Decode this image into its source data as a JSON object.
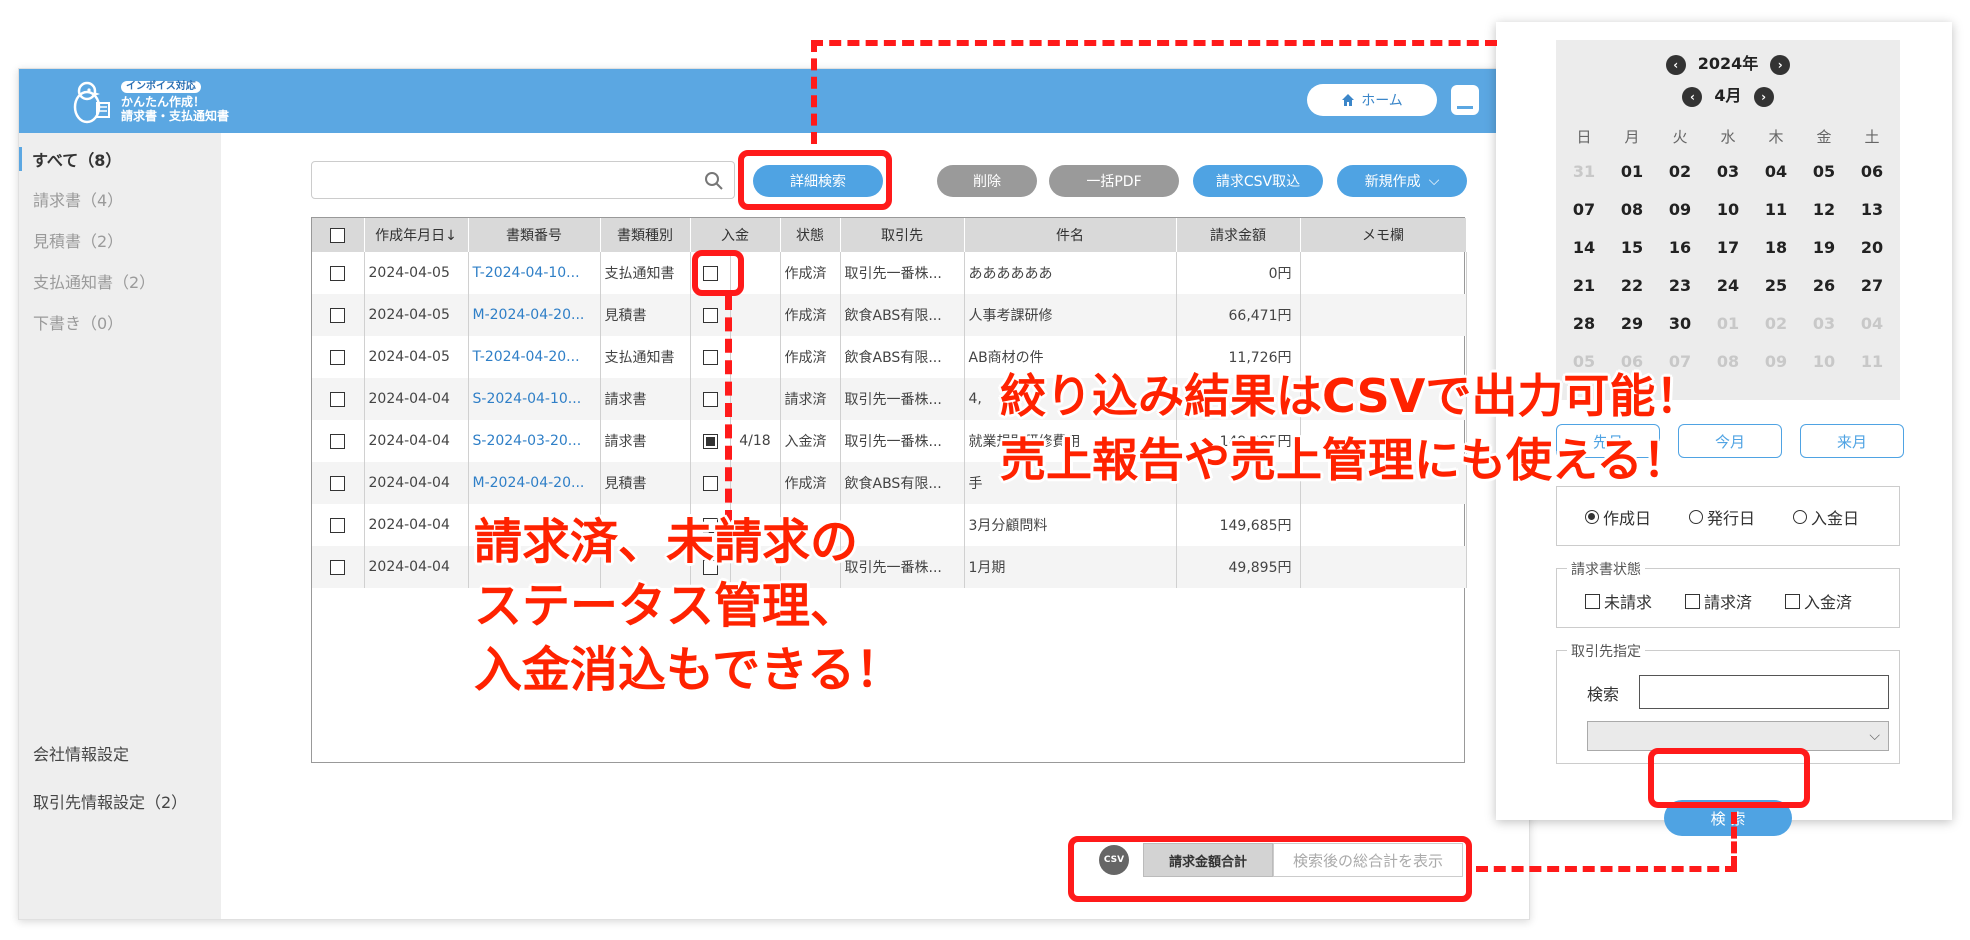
{
  "brand": {
    "badge": "インボイス対応",
    "line1": "かんたん作成！",
    "line2": "請求書・支払通知書"
  },
  "header": {
    "home_label": "ホーム"
  },
  "sidebar": {
    "items": [
      {
        "label": "すべて（8）"
      },
      {
        "label": "請求書（4）"
      },
      {
        "label": "見積書（2）"
      },
      {
        "label": "支払通知書（2）"
      },
      {
        "label": "下書き（0）"
      }
    ],
    "bottom": [
      {
        "label": "会社情報設定"
      },
      {
        "label": "取引先情報設定（2）"
      }
    ]
  },
  "toolbar": {
    "search_placeholder": "",
    "detail_search": "詳細検索",
    "delete": "削除",
    "bulk_pdf": "一括PDF",
    "csv_import": "請求CSV取込",
    "new_create": "新規作成"
  },
  "table": {
    "headers": [
      "",
      "作成年月日↓",
      "書類番号",
      "書類種別",
      "入金",
      "状態",
      "取引先",
      "件名",
      "請求金額",
      "メモ欄"
    ],
    "rows": [
      {
        "date": "2024-04-05",
        "doc_no": "T-2024-04-10...",
        "type": "支払通知書",
        "paid_checked": false,
        "paid_date": "",
        "status": "作成済",
        "client": "取引先一番株...",
        "subject": "ああああああ",
        "amount": "0円"
      },
      {
        "date": "2024-04-05",
        "doc_no": "M-2024-04-20...",
        "type": "見積書",
        "paid_checked": false,
        "paid_date": "",
        "status": "作成済",
        "client": "飲食ABS有限...",
        "subject": "人事考課研修",
        "amount": "66,471円"
      },
      {
        "date": "2024-04-05",
        "doc_no": "T-2024-04-20...",
        "type": "支払通知書",
        "paid_checked": false,
        "paid_date": "",
        "status": "作成済",
        "client": "飲食ABS有限...",
        "subject": "AB商材の件",
        "amount": "11,726円"
      },
      {
        "date": "2024-04-04",
        "doc_no": "S-2024-04-10...",
        "type": "請求書",
        "paid_checked": false,
        "paid_date": "",
        "status": "請求済",
        "client": "取引先一番株...",
        "subject": "4,",
        "amount": ""
      },
      {
        "date": "2024-04-04",
        "doc_no": "S-2024-03-20...",
        "type": "請求書",
        "paid_checked": true,
        "paid_date": "4/18",
        "status": "入金済",
        "client": "取引先一番株...",
        "subject": "就業規則研修費用",
        "amount": "149,685円"
      },
      {
        "date": "2024-04-04",
        "doc_no": "M-2024-04-20...",
        "type": "見積書",
        "paid_checked": false,
        "paid_date": "",
        "status": "作成済",
        "client": "飲食ABS有限...",
        "subject": "手",
        "amount": ""
      },
      {
        "date": "2024-04-04",
        "doc_no": "",
        "type": "",
        "paid_checked": false,
        "paid_date": "",
        "status": "",
        "client": "",
        "subject": "3月分顧問料",
        "amount": "149,685円"
      },
      {
        "date": "2024-04-04",
        "doc_no": "",
        "type": "",
        "paid_checked": false,
        "paid_date": "",
        "status": "",
        "client": "取引先一番株...",
        "subject": "1月期",
        "amount": "49,895円"
      }
    ]
  },
  "total": {
    "csv_icon": "CSV",
    "label": "請求金額合計",
    "value": "検索後の総合計を表示"
  },
  "calendar": {
    "year": "2024年",
    "month": "4月",
    "weekdays": [
      "日",
      "月",
      "火",
      "水",
      "木",
      "金",
      "土"
    ],
    "days": [
      {
        "d": "31",
        "dim": true
      },
      {
        "d": "01"
      },
      {
        "d": "02"
      },
      {
        "d": "03"
      },
      {
        "d": "04"
      },
      {
        "d": "05"
      },
      {
        "d": "06"
      },
      {
        "d": "07"
      },
      {
        "d": "08"
      },
      {
        "d": "09"
      },
      {
        "d": "10"
      },
      {
        "d": "11"
      },
      {
        "d": "12"
      },
      {
        "d": "13"
      },
      {
        "d": "14"
      },
      {
        "d": "15"
      },
      {
        "d": "16"
      },
      {
        "d": "17"
      },
      {
        "d": "18"
      },
      {
        "d": "19"
      },
      {
        "d": "20"
      },
      {
        "d": "21"
      },
      {
        "d": "22"
      },
      {
        "d": "23"
      },
      {
        "d": "24"
      },
      {
        "d": "25"
      },
      {
        "d": "26"
      },
      {
        "d": "27"
      },
      {
        "d": "28"
      },
      {
        "d": "29"
      },
      {
        "d": "30"
      },
      {
        "d": "01",
        "dim": true
      },
      {
        "d": "02",
        "dim": true
      },
      {
        "d": "03",
        "dim": true
      },
      {
        "d": "04",
        "dim": true
      },
      {
        "d": "05",
        "dim": true
      },
      {
        "d": "06",
        "dim": true
      },
      {
        "d": "07",
        "dim": true
      },
      {
        "d": "08",
        "dim": true
      },
      {
        "d": "09",
        "dim": true
      },
      {
        "d": "10",
        "dim": true
      },
      {
        "d": "11",
        "dim": true
      }
    ],
    "month_buttons": [
      "先月",
      "今月",
      "来月"
    ]
  },
  "filters": {
    "date_type": {
      "options": [
        "作成日",
        "発行日",
        "入金日"
      ],
      "selected": 0
    },
    "status": {
      "legend": "請求書状態",
      "options": [
        "未請求",
        "請求済",
        "入金済"
      ]
    },
    "client": {
      "legend": "取引先指定",
      "search_label": "検索"
    },
    "search_button": "検 索"
  },
  "callouts": {
    "left": [
      "請求済、未請求の",
      "ステータス管理、",
      "入金消込もできる！"
    ],
    "right": [
      "絞り込み結果はCSVで出力可能！",
      "売上報告や売上管理にも使える！"
    ]
  },
  "colors": {
    "accent": "#5ba7e2",
    "callout_red": "#ff1a1a"
  }
}
